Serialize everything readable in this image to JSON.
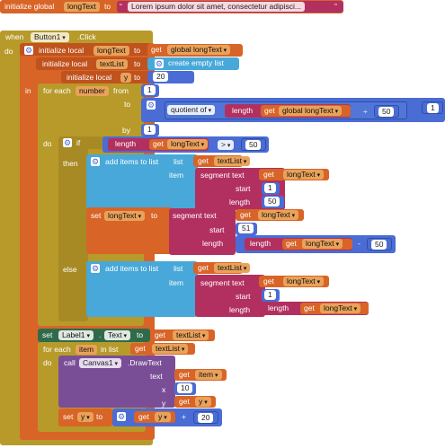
{
  "global_init": {
    "label": "initialize global",
    "name": "longText",
    "to": "to",
    "value": "Lorem ipsum dolor sit amet, consectetur adipisci..."
  },
  "event": {
    "when": "when",
    "component": "Button1",
    "event": ".Click",
    "do": "do"
  },
  "locals": [
    {
      "label": "initialize local",
      "name": "longText",
      "to": "to",
      "get": "get",
      "value": "global longText"
    },
    {
      "label": "initialize local",
      "name": "textList",
      "to": "to",
      "value": "create empty list"
    },
    {
      "label": "initialize local",
      "name": "y",
      "to": "to",
      "value": "20"
    }
  ],
  "in_label": "in",
  "for_range": {
    "label": "for each",
    "var": "number",
    "from_label": "from",
    "from": "1",
    "to_label": "to",
    "quotient_label": "quotient of",
    "length_label": "length",
    "get": "get",
    "length_var": "global longText",
    "divisor": "50",
    "plus": "+",
    "addend": "1",
    "by_label": "by",
    "by": "1",
    "do_label": "do"
  },
  "if_block": {
    "if_label": "if",
    "length_label": "length",
    "get": "get",
    "var": "longText",
    "op": ">",
    "value": "50",
    "then_label": "then",
    "else_label": "else"
  },
  "then_add": {
    "label": "add items to list",
    "list_label": "list",
    "get": "get",
    "list_var": "textList",
    "item_label": "item",
    "segment_label": "segment text",
    "text_var": "longText",
    "start_label": "start",
    "start": "1",
    "length_label": "length",
    "length": "50"
  },
  "set_long": {
    "set_label": "set",
    "var": "longText",
    "to": "to",
    "segment_label": "segment text",
    "get": "get",
    "text_var": "longText",
    "start_label": "start",
    "start": "51",
    "length_label": "length",
    "len_label": "length",
    "len_var": "longText",
    "minus": "-",
    "minus_val": "50"
  },
  "else_add": {
    "label": "add items to list",
    "list_label": "list",
    "get": "get",
    "list_var": "textList",
    "item_label": "item",
    "segment_label": "segment text",
    "text_var": "longText",
    "start_label": "start",
    "start": "1",
    "length_label": "length",
    "len_label": "length",
    "len_var": "longText"
  },
  "set_label1": {
    "set": "set",
    "component": "Label1",
    "prop": "Text",
    "to": "to",
    "get": "get",
    "var": "textList"
  },
  "for_item": {
    "label": "for each",
    "var": "item",
    "in_list": "in list",
    "get": "get",
    "list_var": "textList",
    "do_label": "do"
  },
  "draw": {
    "call": "call",
    "component": "Canvas1",
    "method": ".DrawText",
    "text_label": "text",
    "get": "get",
    "text_var": "item",
    "x_label": "x",
    "x": "10",
    "y_label": "y",
    "y_var": "y"
  },
  "set_y": {
    "set": "set",
    "var": "y",
    "to": "to",
    "get": "get",
    "get_var": "y",
    "plus": "+",
    "value": "20"
  }
}
